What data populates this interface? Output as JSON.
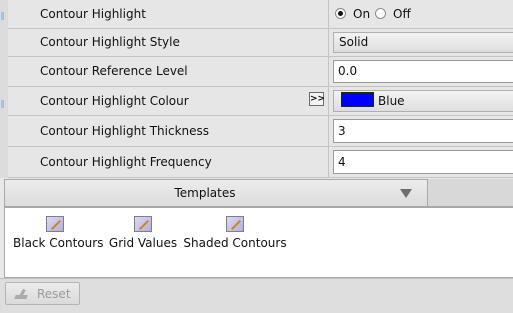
{
  "properties": {
    "contour_highlight": {
      "label": "Contour Highlight",
      "options": [
        "On",
        "Off"
      ],
      "selected": "On"
    },
    "contour_highlight_style": {
      "label": "Contour Highlight Style",
      "value": "Solid"
    },
    "contour_reference_level": {
      "label": "Contour Reference Level",
      "value": "0.0"
    },
    "contour_highlight_colour": {
      "label": "Contour Highlight Colour",
      "more_button": ">>",
      "swatch_color": "#0000ff",
      "value": "Blue"
    },
    "contour_highlight_thickness": {
      "label": "Contour Highlight Thickness",
      "value": "3"
    },
    "contour_highlight_frequency": {
      "label": "Contour Highlight Frequency",
      "value": "4"
    }
  },
  "templates": {
    "tab_label": "Templates",
    "items": [
      {
        "label": "Black Contours",
        "icon": "template-icon"
      },
      {
        "label": "Grid Values",
        "icon": "template-icon"
      },
      {
        "label": "Shaded Contours",
        "icon": "template-icon"
      }
    ]
  },
  "footer": {
    "reset_label": "Reset",
    "reset_icon": "reset-icon"
  }
}
